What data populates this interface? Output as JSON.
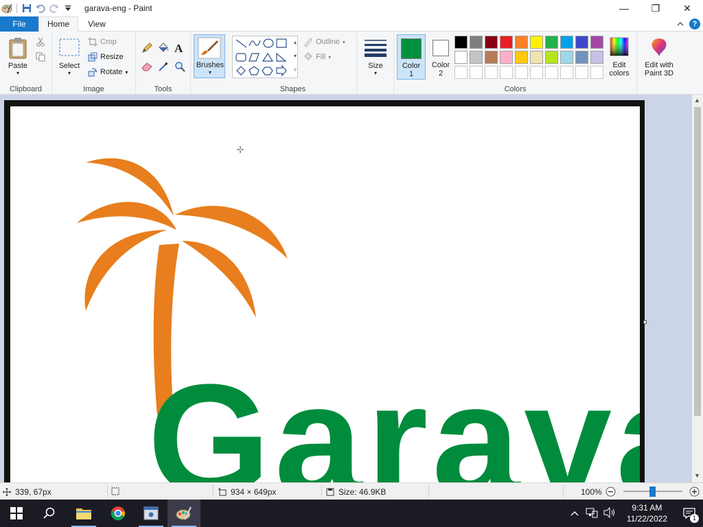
{
  "window": {
    "title": "garava-eng - Paint",
    "minimize": "—",
    "maximize": "❐",
    "close": "✕"
  },
  "tabs": {
    "file": "File",
    "home": "Home",
    "view": "View"
  },
  "ribbon": {
    "clipboard": {
      "paste": "Paste",
      "group": "Clipboard"
    },
    "image": {
      "select": "Select",
      "crop": "Crop",
      "resize": "Resize",
      "rotate": "Rotate",
      "group": "Image"
    },
    "tools": {
      "group": "Tools"
    },
    "brushes": {
      "label": "Brushes"
    },
    "shapes": {
      "outline": "Outline",
      "fill": "Fill",
      "group": "Shapes"
    },
    "size": {
      "label": "Size"
    },
    "colors": {
      "color1_line1": "Color",
      "color1_line2": "1",
      "color2_line1": "Color",
      "color2_line2": "2",
      "edit_line1": "Edit",
      "edit_line2": "colors",
      "group": "Colors",
      "color1_value": "#009140",
      "color2_value": "#ffffff",
      "palette_row1": [
        "#000000",
        "#7f7f7f",
        "#880015",
        "#ed1c24",
        "#ff7f27",
        "#fff200",
        "#22b14c",
        "#00a2e8",
        "#3f48cc",
        "#a349a4"
      ],
      "palette_row2": [
        "#ffffff",
        "#c3c3c3",
        "#b97a57",
        "#ffaec9",
        "#ffc90e",
        "#efe4b0",
        "#b5e61d",
        "#99d9ea",
        "#7092be",
        "#c8bfe7"
      ]
    },
    "paint3d": {
      "line1": "Edit with",
      "line2": "Paint 3D"
    }
  },
  "canvas": {
    "logo_text": "Garava",
    "logo_green": "#008c3c",
    "logo_orange": "#e87e1e"
  },
  "status": {
    "cursor": "339, 67px",
    "dimensions": "934 × 649px",
    "size": "Size: 46.9KB",
    "zoom": "100%",
    "zoom_level": 1.0
  },
  "taskbar": {
    "time": "9:31 AM",
    "date": "11/22/2022",
    "notifications": "1"
  }
}
